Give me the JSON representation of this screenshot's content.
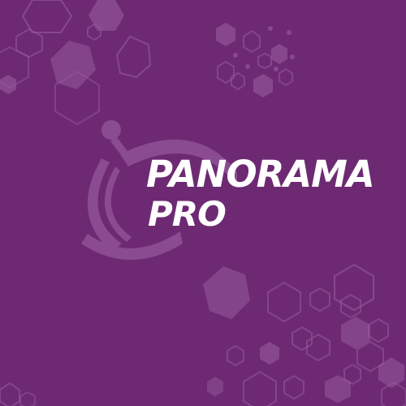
{
  "logo": {
    "line1": "PANORAMA",
    "line2": "PRO"
  },
  "colors": {
    "background": "#6d2a73",
    "text": "#ffffff",
    "decoration": "#9a5ea0"
  },
  "decorations": {
    "emblem_icon": "satellite-dish-icon",
    "pattern": "hexagon-pattern"
  }
}
